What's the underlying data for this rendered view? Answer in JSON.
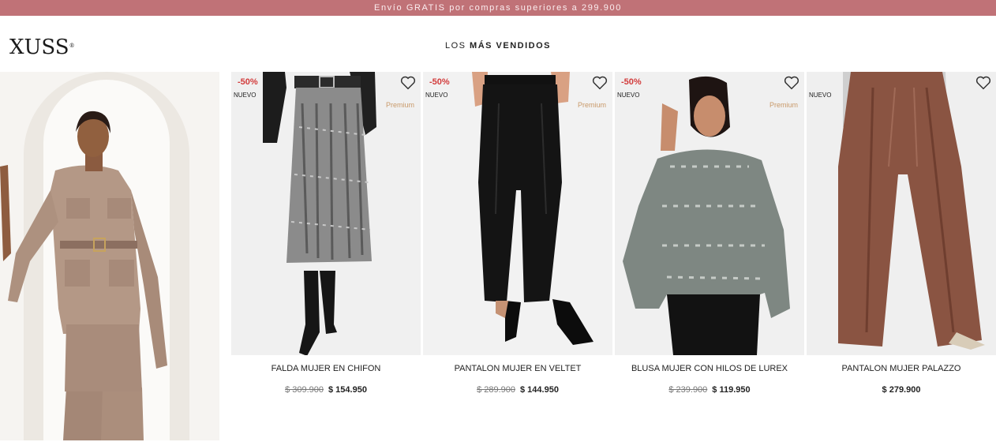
{
  "announcement": "Envío GRATIS por compras superiores a 299.900",
  "brand": {
    "logo": "XUSS",
    "logo_mark": "®"
  },
  "section": {
    "prefix": "LOS ",
    "highlight": "MÁS VENDIDOS"
  },
  "colors": {
    "announcement_bg": "#c07277",
    "discount": "#d23b3b",
    "premium": "#c99a6a"
  },
  "products": [
    {
      "name": "FALDA MUJER EN CHIFON",
      "discount": "-50%",
      "badge_new": "NUEVO",
      "premium": "Premium",
      "old_price": "$ 309.900",
      "price": "$ 154.950",
      "favorite_icon": "heart-icon"
    },
    {
      "name": "PANTALON MUJER EN VELTET",
      "discount": "-50%",
      "badge_new": "NUEVO",
      "premium": "Premium",
      "old_price": "$ 289.900",
      "price": "$ 144.950",
      "favorite_icon": "heart-icon"
    },
    {
      "name": "BLUSA MUJER CON HILOS DE LUREX",
      "discount": "-50%",
      "badge_new": "NUEVO",
      "premium": "Premium",
      "old_price": "$ 239.900",
      "price": "$ 119.950",
      "favorite_icon": "heart-icon"
    },
    {
      "name": "PANTALON MUJER PALAZZO",
      "badge_new": "NUEVO",
      "price": "$ 279.900",
      "favorite_icon": "heart-icon"
    }
  ]
}
